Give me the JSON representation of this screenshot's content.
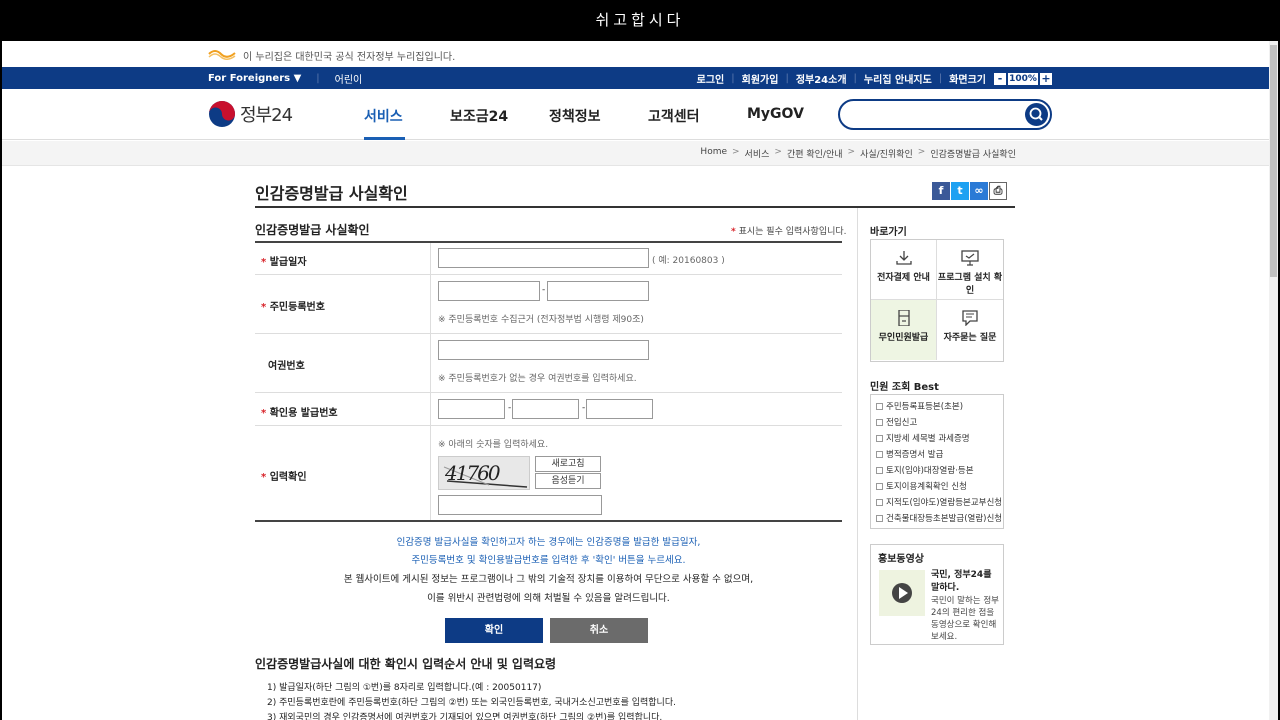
{
  "window": {
    "title": "쉬고합시다"
  },
  "notice": {
    "text": "이 누리집은 대한민국 공식 전자정부 누리집입니다."
  },
  "util": {
    "foreigners": "For Foreigners ▼",
    "kids": "어린이",
    "login": "로그인",
    "join": "회원가입",
    "about": "정부24소개",
    "sitemap": "누리집 안내지도",
    "screen": "화면크기",
    "zoom_minus": "-",
    "zoom_value": "100%",
    "zoom_plus": "+"
  },
  "brand": {
    "name": "정부24"
  },
  "nav": {
    "service": "서비스",
    "subsidy": "보조금24",
    "policy": "정책정보",
    "customer": "고객센터",
    "mygov": "MyGOV"
  },
  "search": {
    "value": ""
  },
  "breadcrumb": [
    "Home",
    "서비스",
    "간편 확인/안내",
    "사실/진위확인",
    "인감증명발급 사실확인"
  ],
  "page": {
    "title": "인감증명발급 사실확인"
  },
  "share": {
    "fb": "f",
    "tw": "t",
    "link": "∞",
    "print": "⎙"
  },
  "form": {
    "title": "인감증명발급 사실확인",
    "required_note": "표시는 필수 입력사항입니다.",
    "required_mark": "*",
    "issue_date_label": "발급일자",
    "issue_date_hint": "( 예: 20160803 )",
    "rrn_label": "주민등록번호",
    "rrn_dash": "-",
    "rrn_hint": "※ 주민등록번호 수집근거 (전자정부법 시행령 제90조)",
    "passport_label": "여권번호",
    "passport_hint": "※ 주민등록번호가 없는 경우 여권번호를 입력하세요.",
    "confirm_no_label": "확인용 발급번호",
    "confirm_dash": "-",
    "captcha_label": "입력확인",
    "captcha_hint": "※ 아래의 숫자를 입력하세요.",
    "captcha_text": "41760",
    "refresh": "새로고침",
    "audio": "음성듣기"
  },
  "info": {
    "line1": "인감증명 발급사실을 확인하고자 하는 경우에는 인감증명을 발급한 발급일자,",
    "line2": "주민등록번호 및 확인용발급번호를 입력한 후 '확인' 버튼을 누르세요.",
    "line3": "본 웹사이트에 게시된 정보는 프로그램이나 그 밖의 기술적 장치를 이용하여 무단으로 사용할 수 없으며,",
    "line4": "이를 위반시 관련법령에 의해 처벌될 수 있음을 알려드립니다."
  },
  "buttons": {
    "ok": "확인",
    "cancel": "취소"
  },
  "guide": {
    "title": "인감증명발급사실에 대한 확인시 입력순서 안내 및 입력요령",
    "step1": "1) 발급일자(하단 그림의 ①번)를 8자리로 입력합니다.(예 : 20050117)",
    "step2": "2) 주민등록번호란에 주민등록번호(하단 그림의 ②번) 또는 외국인등록번호, 국내거소신고번호를 입력합니다.",
    "step3": "3) 재외국민의 경우 인감증명서에 여권번호가 기재되어 있으면 여권번호(하단 그림의 ②번)를 입력합니다."
  },
  "sidebar": {
    "quick_title": "바로가기",
    "quick": [
      "전자결제 안내",
      "프로그램 설치 확인",
      "무인민원발급",
      "자주묻는 질문"
    ],
    "best_title": "민원 조회 Best",
    "best": [
      "주민등록표등본(초본)",
      "전입신고",
      "지방세 세목별 과세증명",
      "병적증명서 발급",
      "토지(임야)대장열람·등본",
      "토지이용계획확인 신청",
      "지적도(임야도)열람등본교부신청",
      "건축물대장등초본발급(열람)신청"
    ],
    "promo_title": "홍보동영상",
    "promo_heading": "국민, 정부24를 말하다.",
    "promo_desc": "국민이 말하는 정부24의 편리한 점을 동영상으로 확인해 보세요."
  },
  "colors": {
    "navy": "#0d3b85",
    "accent": "#1a5fb4",
    "required": "#d8232a",
    "cancel": "#6b6b6b",
    "quick_highlight": "#eef5e3"
  }
}
